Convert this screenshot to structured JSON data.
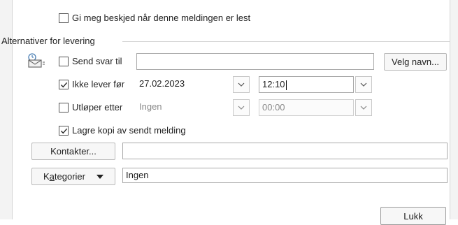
{
  "read_receipt": {
    "label": "Gi meg beskjed når denne meldingen er lest",
    "checked": false
  },
  "delivery_group": {
    "title": "Alternativer for levering"
  },
  "send_replies": {
    "label": "Send svar til",
    "checked": false,
    "value": "",
    "choose_names_button": "Velg navn..."
  },
  "do_not_deliver_before": {
    "label": "Ikke lever før",
    "checked": true,
    "date": "27.02.2023",
    "time": "12:10"
  },
  "expires_after": {
    "label": "Utløper etter",
    "checked": false,
    "date": "Ingen",
    "time": "00:00"
  },
  "save_copy": {
    "label": "Lagre kopi av sendt melding",
    "checked": true
  },
  "contacts": {
    "button": "Kontakter...",
    "value": ""
  },
  "categories": {
    "button_prefix": "K",
    "button_underlined": "a",
    "button_rest": "tegorier",
    "value": "Ingen"
  },
  "close_button": "Lukk",
  "icons": {
    "delivery": "envelope-clock-icon",
    "dropdown": "chevron-down-icon",
    "check": "check-mark-icon"
  }
}
